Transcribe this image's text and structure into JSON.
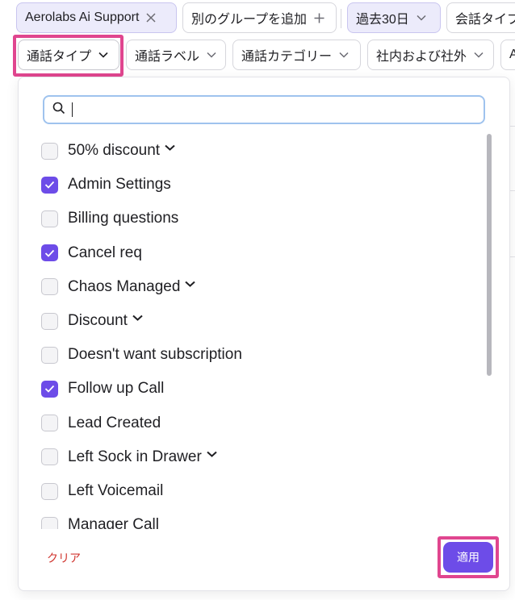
{
  "top_row": {
    "group_chip": "Aerolabs Ai Support",
    "add_group_chip": "別のグループを追加",
    "period_chip": "過去30日",
    "call_type_chip": "会話タイプ"
  },
  "filter_row": {
    "call_type": "通話タイプ",
    "call_label": "通話ラベル",
    "call_category": "通話カテゴリー",
    "internal_external": "社内および社外",
    "partial": "A"
  },
  "dropdown": {
    "search_value": "",
    "items": [
      {
        "label": "50% discount",
        "checked": false,
        "expandable": true
      },
      {
        "label": "Admin Settings",
        "checked": true,
        "expandable": false
      },
      {
        "label": "Billing questions",
        "checked": false,
        "expandable": false
      },
      {
        "label": "Cancel req",
        "checked": true,
        "expandable": false
      },
      {
        "label": "Chaos Managed",
        "checked": false,
        "expandable": true
      },
      {
        "label": "Discount",
        "checked": false,
        "expandable": true
      },
      {
        "label": "Doesn't want subscription",
        "checked": false,
        "expandable": false
      },
      {
        "label": "Follow up Call",
        "checked": true,
        "expandable": false
      },
      {
        "label": "Lead Created",
        "checked": false,
        "expandable": false
      },
      {
        "label": "Left Sock in Drawer",
        "checked": false,
        "expandable": true
      },
      {
        "label": "Left Voicemail",
        "checked": false,
        "expandable": false
      },
      {
        "label": "Manager Call",
        "checked": false,
        "expandable": false
      }
    ],
    "clear_label": "クリア",
    "apply_label": "適用"
  },
  "colors": {
    "accent": "#6d4ce8",
    "highlight": "#e0468f",
    "clear": "#d0352f"
  }
}
